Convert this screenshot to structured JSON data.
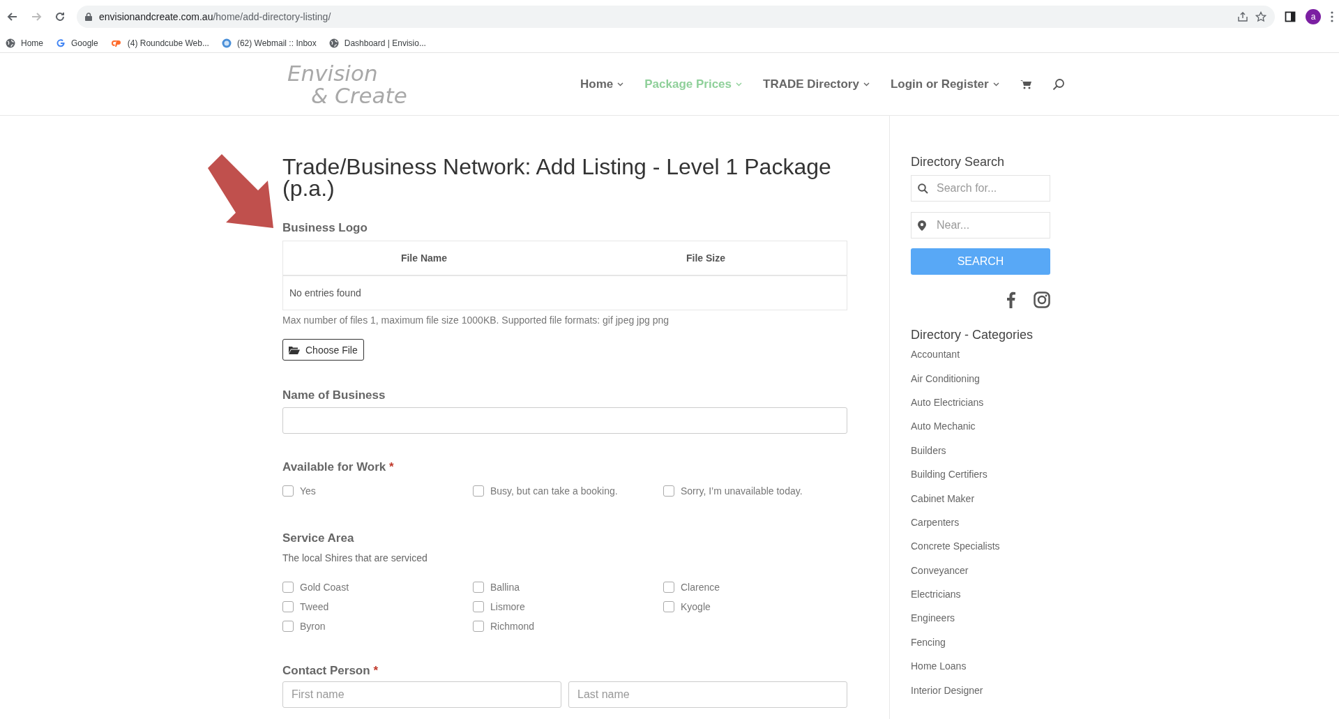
{
  "browser": {
    "url_host": "envisionandcreate.com.au",
    "url_path": "/home/add-directory-listing/",
    "avatar": "a",
    "bookmarks": [
      {
        "label": "Home",
        "kind": "globe"
      },
      {
        "label": "Google",
        "kind": "google"
      },
      {
        "label": "(4) Roundcube Web...",
        "kind": "cpanel"
      },
      {
        "label": "(62) Webmail :: Inbox",
        "kind": "webmail"
      },
      {
        "label": "Dashboard | Envisio...",
        "kind": "globe"
      }
    ]
  },
  "site": {
    "logo": {
      "line_1": "Envision",
      "line_2": "& Create"
    },
    "nav": [
      {
        "label": "Home",
        "selected": false
      },
      {
        "label": "Package Prices",
        "selected": true
      },
      {
        "label": "TRADE Directory",
        "selected": false
      },
      {
        "label": "Login or Register",
        "selected": false
      }
    ]
  },
  "form": {
    "title": "Trade/Business Network: Add Listing - Level 1 Package (p.a.)",
    "logo_section": {
      "label": "Business Logo",
      "columns": [
        "File Name",
        "File Size"
      ],
      "empty_text": "No entries found",
      "help": "Max number of files 1, maximum file size 1000KB. Supported file formats: gif jpeg jpg png",
      "button": "Choose File"
    },
    "business_name": {
      "label": "Name of Business"
    },
    "availability": {
      "label": "Available for Work",
      "required_mark": "*",
      "options": [
        {
          "label": "Yes",
          "checked": false
        },
        {
          "label": "Busy, but can take a booking.",
          "checked": false
        },
        {
          "label": "Sorry, I’m unavailable today.",
          "checked": false
        }
      ]
    },
    "service_area": {
      "label": "Service Area",
      "description": "The local Shires that are serviced",
      "options": [
        {
          "label": "Gold Coast",
          "checked": false
        },
        {
          "label": "Ballina",
          "checked": false
        },
        {
          "label": "Clarence",
          "checked": false
        },
        {
          "label": "Tweed",
          "checked": false
        },
        {
          "label": "Lismore",
          "checked": false
        },
        {
          "label": "Kyogle",
          "checked": false
        },
        {
          "label": "Byron",
          "checked": false
        },
        {
          "label": "Richmond",
          "checked": false
        }
      ]
    },
    "contact": {
      "label": "Contact Person",
      "required_mark": "*",
      "first_placeholder": "First name",
      "last_placeholder": "Last name"
    }
  },
  "sidebar": {
    "search_title": "Directory Search",
    "search_placeholder": "Search for...",
    "near_placeholder": "Near...",
    "search_button": "SEARCH",
    "categories_title": "Directory - Categories",
    "categories": [
      "Accountant",
      "Air Conditioning",
      "Auto Electricians",
      "Auto Mechanic",
      "Builders",
      "Building Certifiers",
      "Cabinet Maker",
      "Carpenters",
      "Concrete Specialists",
      "Conveyancer",
      "Electricians",
      "Engineers",
      "Fencing",
      "Home Loans",
      "Interior Designer"
    ]
  }
}
